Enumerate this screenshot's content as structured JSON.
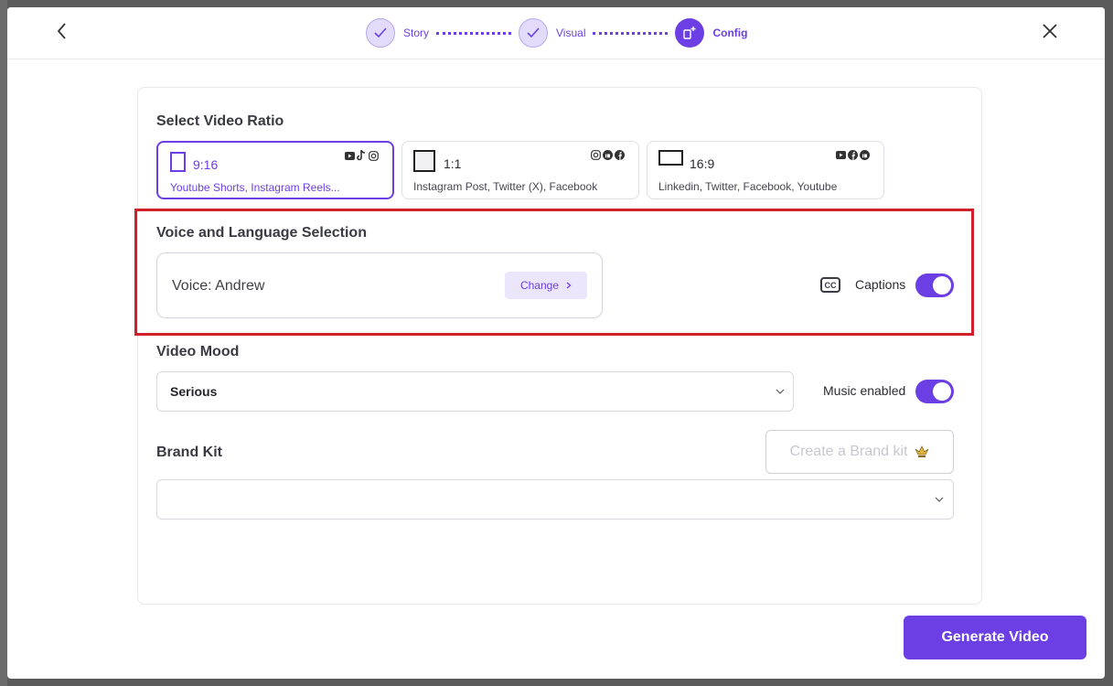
{
  "header": {
    "steps": [
      {
        "label": "Story",
        "state": "done"
      },
      {
        "label": "Visual",
        "state": "done"
      },
      {
        "label": "Config",
        "state": "active"
      }
    ]
  },
  "ratio_section": {
    "title": "Select Video Ratio",
    "options": [
      {
        "ratio": "9:16",
        "platforms": "Youtube Shorts, Instagram Reels...",
        "selected": true,
        "icons": [
          "youtube-icon",
          "tiktok-icon",
          "instagram-icon"
        ]
      },
      {
        "ratio": "1:1",
        "platforms": "Instagram Post, Twitter (X), Facebook",
        "selected": false,
        "icons": [
          "instagram-icon",
          "linkedin-icon",
          "facebook-icon"
        ]
      },
      {
        "ratio": "16:9",
        "platforms": "Linkedin, Twitter, Facebook, Youtube",
        "selected": false,
        "icons": [
          "youtube-icon",
          "facebook-icon",
          "linkedin-icon"
        ]
      }
    ]
  },
  "voice_section": {
    "title": "Voice and Language Selection",
    "voice_label": "Voice: Andrew",
    "change_label": "Change",
    "captions_label": "Captions",
    "captions_on": true,
    "cc_text": "CC"
  },
  "mood_section": {
    "title": "Video Mood",
    "selected": "Serious",
    "music_label": "Music enabled",
    "music_on": true
  },
  "brand_section": {
    "title": "Brand Kit",
    "create_label": "Create a Brand kit",
    "selected": ""
  },
  "footer": {
    "generate_label": "Generate Video"
  },
  "colors": {
    "accent": "#6b3fe3",
    "highlight": "#d2202a"
  }
}
